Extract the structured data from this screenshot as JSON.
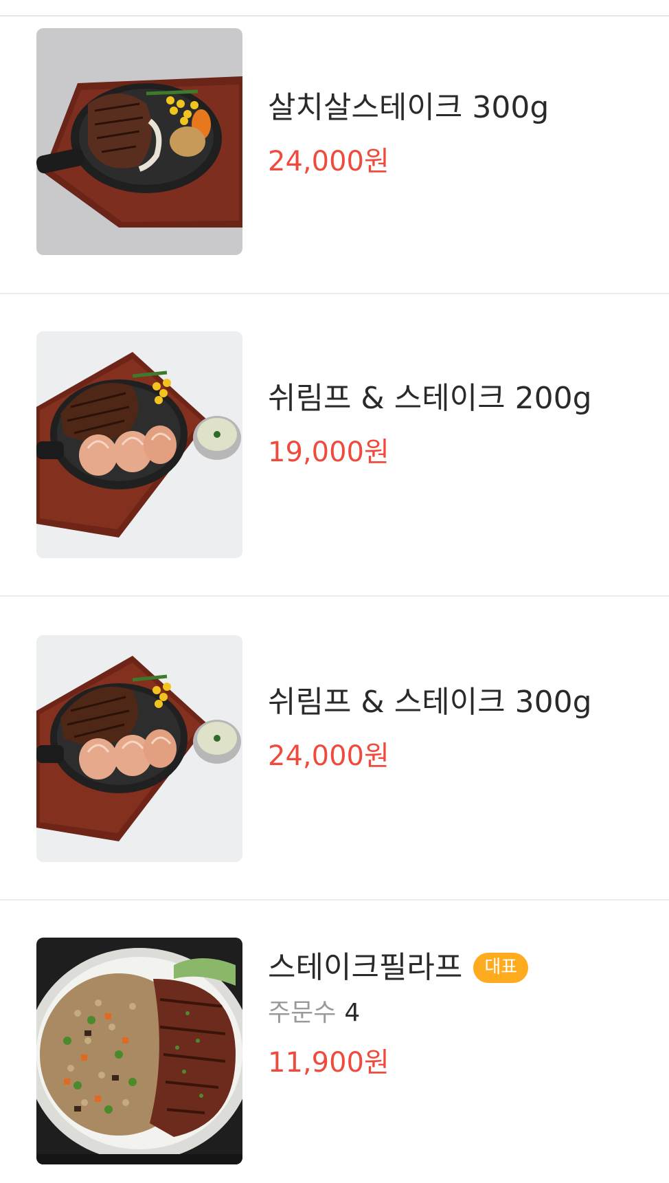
{
  "menu": {
    "items": [
      {
        "name": "살치살스테이크 300g",
        "price": "24,000원",
        "image_icon": "steak-plate-image"
      },
      {
        "name": "쉬림프 & 스테이크 200g",
        "price": "19,000원",
        "image_icon": "shrimp-steak-image"
      },
      {
        "name": "쉬림프 & 스테이크 300g",
        "price": "24,000원",
        "image_icon": "shrimp-steak-image"
      },
      {
        "name": "스테이크필라프",
        "badge": "대표",
        "orders_label": "주문수",
        "orders_count": "4",
        "price": "11,900원",
        "image_icon": "steak-pilaf-image"
      }
    ]
  },
  "colors": {
    "price": "#f04a3c",
    "badge": "#ffab1f",
    "name": "#2a2a2a",
    "muted": "#9a9a9a"
  }
}
